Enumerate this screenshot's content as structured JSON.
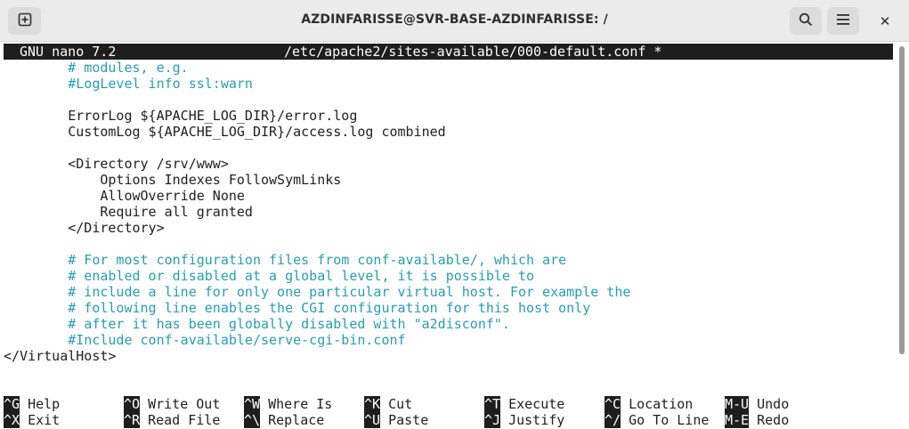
{
  "window": {
    "title": "AZDINFARISSE@SVR-BASE-AZDINFARISSE: /",
    "buttons": {
      "new_tab_icon": "plus-square-icon",
      "search_icon": "magnifier-icon",
      "menu_icon": "hamburger-icon",
      "close_glyph": "✕"
    }
  },
  "nano": {
    "version": "GNU nano 7.2",
    "filename": "/etc/apache2/sites-available/000-default.conf *"
  },
  "editor_lines": [
    {
      "text": "        # modules, e.g.",
      "kind": "comment"
    },
    {
      "text": "        #LogLevel info ssl:warn",
      "kind": "comment"
    },
    {
      "text": "",
      "kind": "code"
    },
    {
      "text": "        ErrorLog ${APACHE_LOG_DIR}/error.log",
      "kind": "code"
    },
    {
      "text": "        CustomLog ${APACHE_LOG_DIR}/access.log combined",
      "kind": "code"
    },
    {
      "text": "",
      "kind": "code"
    },
    {
      "text": "        <Directory /srv/www>",
      "kind": "code"
    },
    {
      "text": "            Options Indexes FollowSymLinks",
      "kind": "code"
    },
    {
      "text": "            AllowOverride None",
      "kind": "code"
    },
    {
      "text": "            Require all granted",
      "kind": "code"
    },
    {
      "text": "        </Directory>",
      "kind": "code"
    },
    {
      "text": "",
      "kind": "code"
    },
    {
      "text": "        # For most configuration files from conf-available/, which are",
      "kind": "comment"
    },
    {
      "text": "        # enabled or disabled at a global level, it is possible to",
      "kind": "comment"
    },
    {
      "text": "        # include a line for only one particular virtual host. For example the",
      "kind": "comment"
    },
    {
      "text": "        # following line enables the CGI configuration for this host only",
      "kind": "comment"
    },
    {
      "text": "        # after it has been globally disabled with \"a2disconf\".",
      "kind": "comment"
    },
    {
      "text": "        #Include conf-available/serve-cgi-bin.conf",
      "kind": "comment"
    },
    {
      "text": "</VirtualHost>",
      "kind": "code"
    }
  ],
  "shortcuts": [
    [
      {
        "key": "^G",
        "label": "Help"
      },
      {
        "key": "^O",
        "label": "Write Out"
      },
      {
        "key": "^W",
        "label": "Where Is"
      },
      {
        "key": "^K",
        "label": "Cut"
      },
      {
        "key": "^T",
        "label": "Execute"
      },
      {
        "key": "^C",
        "label": "Location"
      },
      {
        "key": "M-U",
        "label": "Undo"
      }
    ],
    [
      {
        "key": "^X",
        "label": "Exit"
      },
      {
        "key": "^R",
        "label": "Read File"
      },
      {
        "key": "^\\",
        "label": "Replace"
      },
      {
        "key": "^U",
        "label": "Paste"
      },
      {
        "key": "^J",
        "label": "Justify"
      },
      {
        "key": "^/",
        "label": "Go To Line"
      },
      {
        "key": "M-E",
        "label": "Redo"
      }
    ]
  ],
  "colors": {
    "comment": "#2a9cb0",
    "text": "#1e1e1e",
    "header_bg": "#1e1e1e"
  }
}
